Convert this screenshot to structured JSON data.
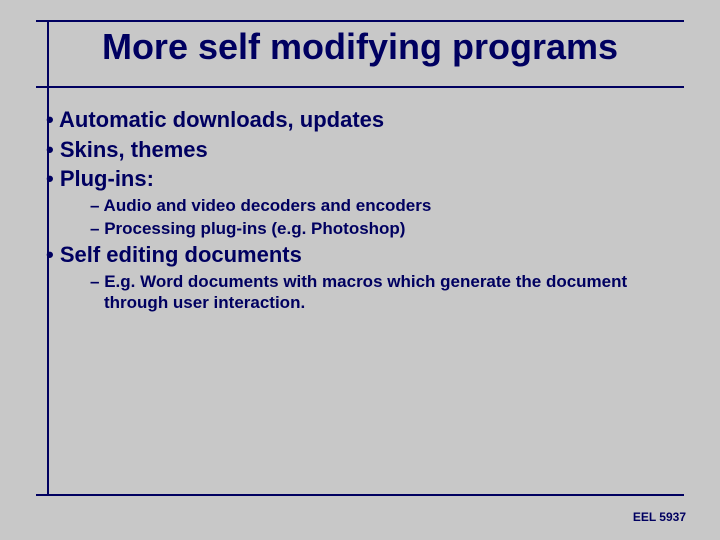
{
  "title": "More self modifying programs",
  "bullets": {
    "b1": "Automatic downloads, updates",
    "b2": "Skins, themes",
    "b3": "Plug-ins:",
    "b3_1": "Audio and video decoders and encoders",
    "b3_2": "Processing plug-ins (e.g. Photoshop)",
    "b4": "Self editing documents",
    "b4_1": "E.g. Word documents with macros which generate the document through user interaction."
  },
  "footer": "EEL 5937"
}
